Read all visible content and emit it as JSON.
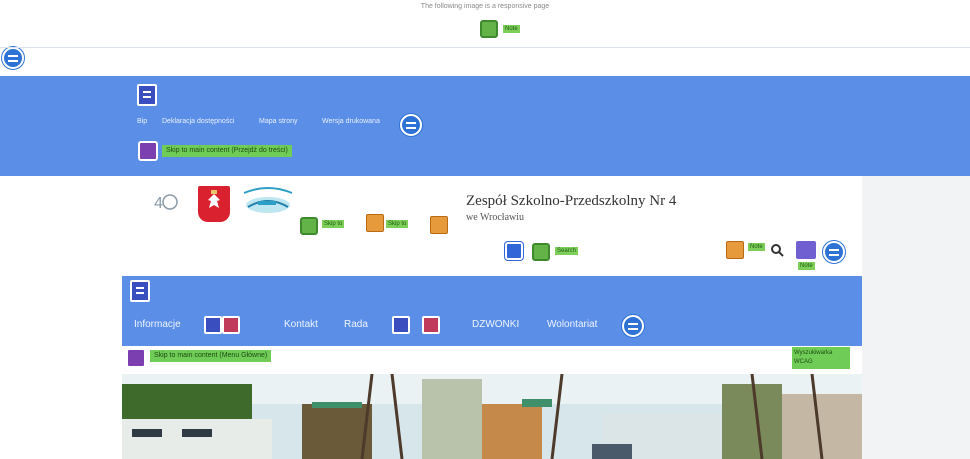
{
  "notice": {
    "top_text": "The following image is a responsive page",
    "badge": "Note"
  },
  "top_nav": {
    "items": [
      "Bip",
      "Deklaracja dostępności",
      "Mapa strony",
      "Wersja drukowana"
    ],
    "skip_link": "Skip to main content (Przejdź do treści)"
  },
  "header": {
    "title": "Zespół Szkolno-Przedszkolny Nr 4",
    "subtitle": "we Wrocławiu",
    "badge_labels": [
      "Skip to",
      "Skip to",
      "Search",
      "Note",
      "Note"
    ]
  },
  "main_nav": {
    "items": [
      "Informacje",
      "Kontakt",
      "Rada",
      "DZWONKI",
      "Wolontariat"
    ],
    "skip_label": "Skip to main content (Menu Główne)",
    "right_label": "Wyszukiwarka WCAG"
  },
  "colors": {
    "band": "#5b8ee6",
    "accent_green": "#6fcc56",
    "purple": "#7b3fb0"
  }
}
